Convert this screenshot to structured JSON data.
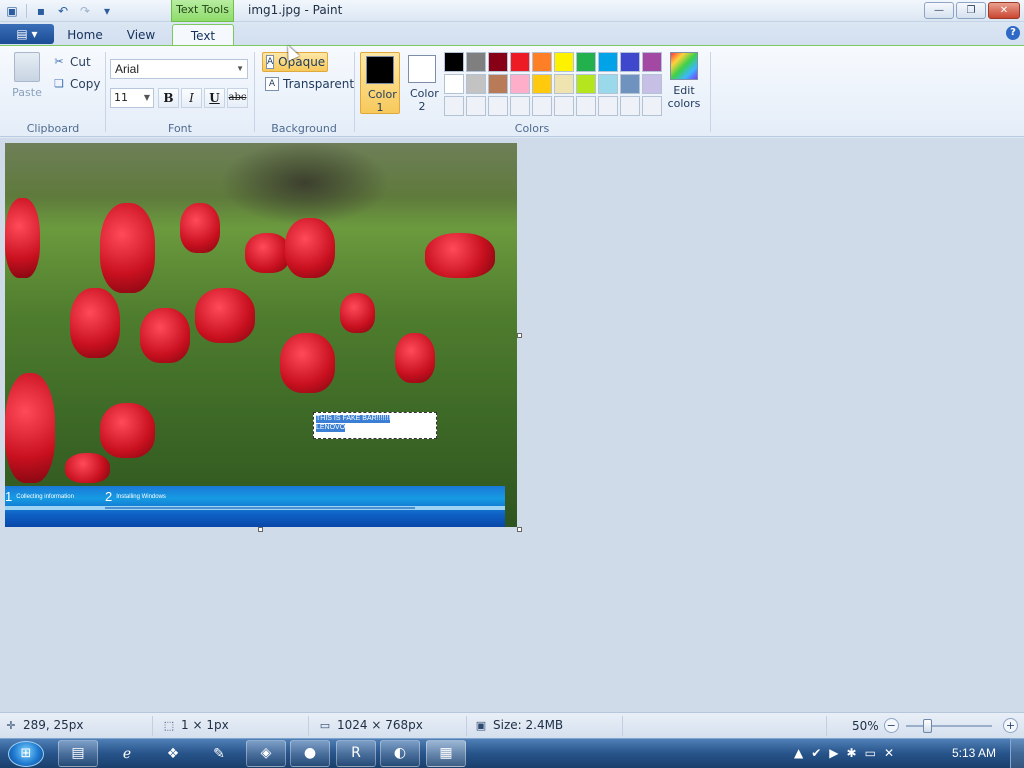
{
  "window": {
    "title": "img1.jpg - Paint",
    "context_tab": "Text Tools"
  },
  "quick_access": [
    "save-icon",
    "undo-icon",
    "redo-icon",
    "customize-icon"
  ],
  "ribbon_tabs": {
    "menu": "▤ ▾",
    "home": "Home",
    "view": "View",
    "text": "Text"
  },
  "clipboard": {
    "paste": "Paste",
    "cut": "Cut",
    "copy": "Copy",
    "label": "Clipboard"
  },
  "font": {
    "family": "Arial",
    "size": "11",
    "bold": "B",
    "italic": "I",
    "underline": "U",
    "strikethrough": "abc",
    "label": "Font"
  },
  "background": {
    "opaque": "Opaque",
    "transparent": "Transparent",
    "label": "Background"
  },
  "colors": {
    "color1_label": "Color 1",
    "color2_label": "Color 2",
    "color1_value": "#000000",
    "color2_value": "#ffffff",
    "edit": "Edit colors",
    "label": "Colors",
    "palette": [
      "#000000",
      "#7f7f7f",
      "#880015",
      "#ed1c24",
      "#ff7f27",
      "#fff200",
      "#22b14c",
      "#00a2e8",
      "#3f48cc",
      "#a349a4",
      "#ffffff",
      "#c3c3c3",
      "#b97a57",
      "#ffaec9",
      "#ffc90e",
      "#efe4b0",
      "#b5e61d",
      "#99d9ea",
      "#7092be",
      "#c8bfe7",
      "#eef2f8",
      "#eef2f8",
      "#eef2f8",
      "#eef2f8",
      "#eef2f8",
      "#eef2f8",
      "#eef2f8",
      "#eef2f8",
      "#eef2f8",
      "#eef2f8"
    ]
  },
  "canvas": {
    "text_line1": "THIS IS FAKE BAR!!!!!!!",
    "text_line2": "LENOVO",
    "step1_num": "1",
    "step1_label": "Collecting information",
    "step2_num": "2",
    "step2_label": "Installing Windows"
  },
  "status": {
    "cursor_pos": "289, 25px",
    "selection_size": "1 × 1px",
    "image_size": "1024 × 768px",
    "file_size": "Size: 2.4MB",
    "zoom": "50%",
    "zoom_out": "−",
    "zoom_in": "+"
  },
  "taskbar": {
    "start": "⊞",
    "clock": "5:13 AM"
  }
}
